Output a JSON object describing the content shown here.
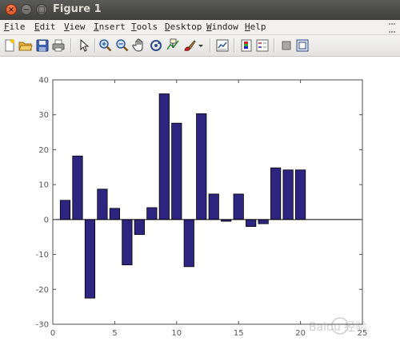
{
  "window": {
    "title": "Figure 1",
    "close_glyph": "×",
    "minimize_glyph": "−",
    "maximize_glyph": "□"
  },
  "menu": {
    "items": [
      {
        "key": "F",
        "rest": "ile"
      },
      {
        "key": "E",
        "rest": "dit"
      },
      {
        "key": "V",
        "rest": "iew"
      },
      {
        "key": "I",
        "rest": "nsert"
      },
      {
        "key": "T",
        "rest": "ools"
      },
      {
        "key": "D",
        "rest": "esktop"
      },
      {
        "key": "W",
        "rest": "indow"
      },
      {
        "key": "H",
        "rest": "elp"
      }
    ]
  },
  "toolbar": {
    "icons": [
      "new-file-icon",
      "open-folder-icon",
      "save-icon",
      "print-icon",
      "select-arrow-icon",
      "zoom-in-icon",
      "zoom-out-icon",
      "pan-hand-icon",
      "rotate-3d-icon",
      "data-cursor-icon",
      "brush-icon",
      "brush-dropdown-icon",
      "link-plot-icon",
      "colorbar-icon",
      "legend-icon",
      "hide-plot-tools-icon",
      "show-plot-tools-icon"
    ]
  },
  "colors": {
    "bar_fill": "#2d2580",
    "bar_stroke": "#000000",
    "axis": "#4d4d4d",
    "tick_text": "#555555"
  },
  "chart_data": {
    "type": "bar",
    "x": [
      1,
      2,
      3,
      4,
      5,
      6,
      7,
      8,
      9,
      10,
      11,
      12,
      13,
      14,
      15,
      16,
      17,
      18,
      19,
      20
    ],
    "values": [
      5.5,
      18.2,
      -22.5,
      8.7,
      3.2,
      -13.0,
      -4.3,
      3.4,
      36.0,
      27.6,
      -13.5,
      30.3,
      7.3,
      -0.5,
      7.3,
      -2.0,
      -1.2,
      14.8,
      14.2,
      14.2
    ],
    "xlim": [
      0,
      25
    ],
    "ylim": [
      -30,
      40
    ],
    "xticks": [
      0,
      5,
      10,
      15,
      20,
      25
    ],
    "yticks": [
      -30,
      -20,
      -10,
      0,
      10,
      20,
      30,
      40
    ],
    "grid": false,
    "title": "",
    "xlabel": "",
    "ylabel": ""
  },
  "watermark": {
    "text": "Baidu 经验"
  }
}
